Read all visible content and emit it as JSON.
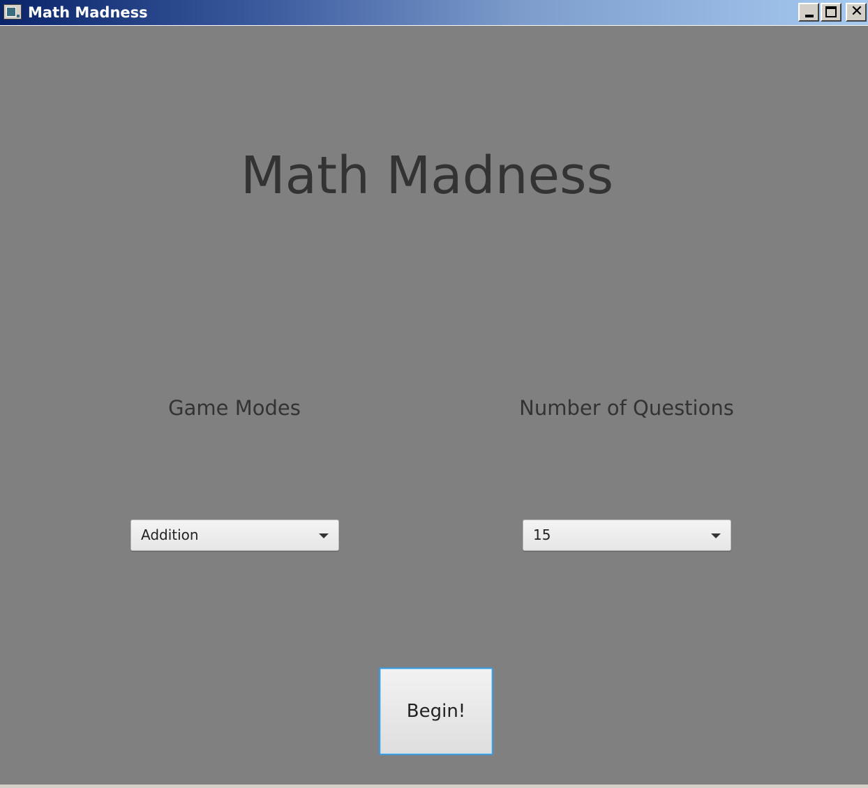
{
  "window": {
    "title": "Math Madness",
    "controls": {
      "minimize_icon": "minimize-icon",
      "maximize_icon": "maximize-icon",
      "close_glyph": "✕"
    },
    "colors": {
      "titlebar_start": "#0a246a",
      "titlebar_end": "#a6caf0",
      "content_background": "#808080",
      "text": "#333333",
      "focus_border": "#3c9bd8"
    }
  },
  "main": {
    "heading": "Math Madness",
    "game_modes": {
      "label": "Game Modes",
      "selected": "Addition"
    },
    "question_count": {
      "label": "Number of Questions",
      "selected": "15"
    },
    "begin_label": "Begin!"
  }
}
